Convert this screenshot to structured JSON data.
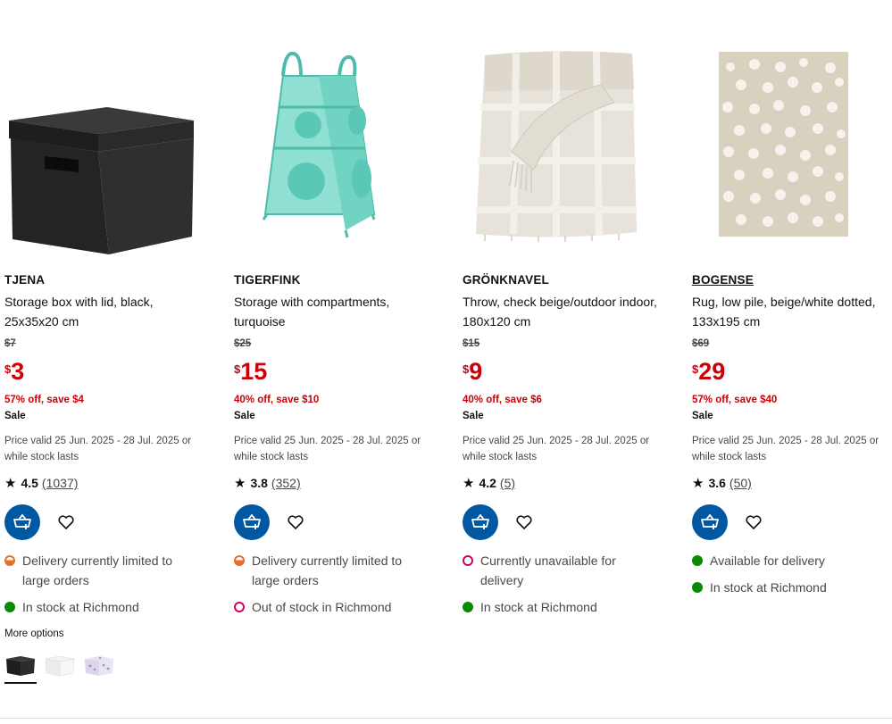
{
  "products": [
    {
      "name": "TJENA",
      "description": "Storage box with lid, black, 25x35x20 cm",
      "was_price": "$7",
      "currency": "$",
      "price": "3",
      "discount": "57% off, save $4",
      "badge": "Sale",
      "validity": "Price valid 25 Jun. 2025 - 28 Jul. 2025 or while stock lasts",
      "rating": "4.5",
      "review_count": "(1037)",
      "availability": [
        {
          "text": "Delivery currently limited to large orders",
          "status": "limited"
        },
        {
          "text": "In stock at Richmond",
          "status": "in-stock"
        }
      ]
    },
    {
      "name": "TIGERFINK",
      "description": "Storage with compartments, turquoise",
      "was_price": "$25",
      "currency": "$",
      "price": "15",
      "discount": "40% off, save $10",
      "badge": "Sale",
      "validity": "Price valid 25 Jun. 2025 - 28 Jul. 2025 or while stock lasts",
      "rating": "3.8",
      "review_count": "(352)",
      "availability": [
        {
          "text": "Delivery currently limited to large orders",
          "status": "limited"
        },
        {
          "text": "Out of stock in Richmond",
          "status": "out-of-stock"
        }
      ]
    },
    {
      "name": "GRÖNKNAVEL",
      "description": "Throw, check beige/outdoor indoor, 180x120 cm",
      "was_price": "$15",
      "currency": "$",
      "price": "9",
      "discount": "40% off, save $6",
      "badge": "Sale",
      "validity": "Price valid 25 Jun. 2025 - 28 Jul. 2025 or while stock lasts",
      "rating": "4.2",
      "review_count": "(5)",
      "availability": [
        {
          "text": "Currently unavailable for delivery",
          "status": "unavailable"
        },
        {
          "text": "In stock at Richmond",
          "status": "in-stock"
        }
      ]
    },
    {
      "name": "BOGENSE",
      "description": "Rug, low pile, beige/white dotted, 133x195 cm",
      "was_price": "$69",
      "currency": "$",
      "price": "29",
      "discount": "57% off, save $40",
      "badge": "Sale",
      "validity": "Price valid 25 Jun. 2025 - 28 Jul. 2025 or while stock lasts",
      "rating": "3.6",
      "review_count": "(50)",
      "availability": [
        {
          "text": "Available for delivery",
          "status": "in-stock"
        },
        {
          "text": "In stock at Richmond",
          "status": "in-stock"
        }
      ]
    }
  ],
  "more_options": {
    "label": "More options",
    "swatches": [
      "black",
      "white",
      "lilac-pattern"
    ],
    "selected": "black"
  },
  "colors": {
    "price_red": "#cc0008",
    "cart_blue": "#0058a3",
    "in_stock_green": "#0a8a00",
    "out_of_stock_magenta": "#cc0066",
    "limited_orange": "#e86e2c"
  },
  "icons": {
    "rating": "star-icon",
    "cart": "add-to-cart-icon",
    "favourite": "heart-icon"
  }
}
